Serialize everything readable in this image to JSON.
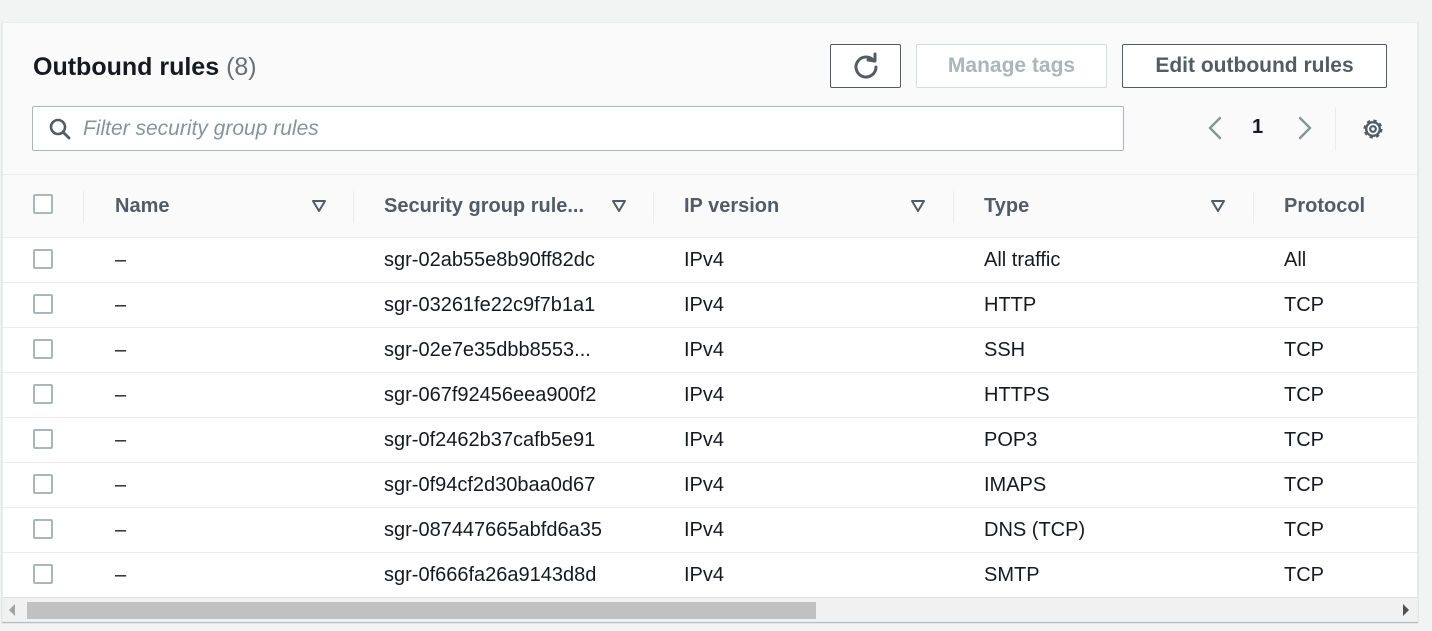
{
  "header": {
    "title": "Outbound rules",
    "count": "(8)",
    "manage_tags_label": "Manage tags",
    "edit_label": "Edit outbound rules"
  },
  "search": {
    "placeholder": "Filter security group rules"
  },
  "pagination": {
    "current_page": "1"
  },
  "columns": {
    "name": "Name",
    "rule_id": "Security group rule...",
    "ip_version": "IP version",
    "type": "Type",
    "protocol": "Protocol"
  },
  "rows": [
    {
      "name": "–",
      "rule_id": "sgr-02ab55e8b90ff82dc",
      "ip_version": "IPv4",
      "type": "All traffic",
      "protocol": "All"
    },
    {
      "name": "–",
      "rule_id": "sgr-03261fe22c9f7b1a1",
      "ip_version": "IPv4",
      "type": "HTTP",
      "protocol": "TCP"
    },
    {
      "name": "–",
      "rule_id": "sgr-02e7e35dbb8553...",
      "ip_version": "IPv4",
      "type": "SSH",
      "protocol": "TCP"
    },
    {
      "name": "–",
      "rule_id": "sgr-067f92456eea900f2",
      "ip_version": "IPv4",
      "type": "HTTPS",
      "protocol": "TCP"
    },
    {
      "name": "–",
      "rule_id": "sgr-0f2462b37cafb5e91",
      "ip_version": "IPv4",
      "type": "POP3",
      "protocol": "TCP"
    },
    {
      "name": "–",
      "rule_id": "sgr-0f94cf2d30baa0d67",
      "ip_version": "IPv4",
      "type": "IMAPS",
      "protocol": "TCP"
    },
    {
      "name": "–",
      "rule_id": "sgr-087447665abfd6a35",
      "ip_version": "IPv4",
      "type": "DNS (TCP)",
      "protocol": "TCP"
    },
    {
      "name": "–",
      "rule_id": "sgr-0f666fa26a9143d8d",
      "ip_version": "IPv4",
      "type": "SMTP",
      "protocol": "TCP"
    }
  ],
  "icons": {
    "refresh": "refresh-icon",
    "search": "search-icon",
    "prev": "chevron-left-icon",
    "next": "chevron-right-icon",
    "settings": "gear-icon",
    "sort": "caret-down-icon"
  },
  "colors": {
    "text": "#16191f",
    "muted": "#545b64",
    "disabled": "#aab7b8",
    "border": "#eaeded"
  }
}
